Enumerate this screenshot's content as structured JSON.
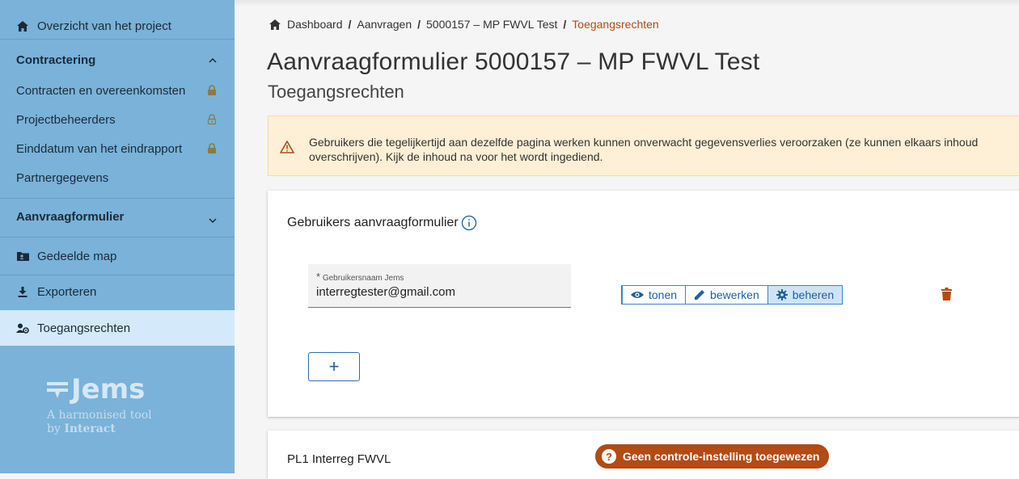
{
  "sidebar": {
    "overview": "Overzicht van het project",
    "contracting": {
      "title": "Contractering",
      "items": [
        {
          "label": "Contracten en overeenkomsten",
          "lock": "locked"
        },
        {
          "label": "Projectbeheerders",
          "lock": "unlocked"
        },
        {
          "label": "Einddatum van het eindrapport",
          "lock": "locked"
        },
        {
          "label": "Partnergegevens"
        }
      ]
    },
    "application_form": "Aanvraagformulier",
    "shared_folder": "Gedeelde map",
    "export": "Exporteren",
    "access_rights": "Toegangsrechten",
    "logo": {
      "name": "Jems",
      "tagline_1": "A harmonised tool",
      "tagline_2_prefix": "by ",
      "tagline_2_brand": "Interact"
    }
  },
  "breadcrumb": {
    "items": [
      "Dashboard",
      "Aanvragen",
      "5000157 – MP FWVL Test"
    ],
    "current": "Toegangsrechten",
    "separator": "/"
  },
  "page": {
    "title": "Aanvraagformulier 5000157 – MP FWVL Test",
    "subtitle": "Toegangsrechten"
  },
  "warning": {
    "text": "Gebruikers die tegelijkertijd aan dezelfde pagina werken kunnen onverwacht gegevensverlies veroorzaken (ze kunnen elkaars inhoud overschrijven). Kijk de inhoud na voor het wordt ingediend."
  },
  "users_card": {
    "title": "Gebruikers aanvraagformulier",
    "field_label": "Gebruikersnaam Jems",
    "field_required_mark": "*",
    "field_value": "interregtester@gmail.com",
    "permissions": [
      {
        "label": "tonen",
        "icon": "eye-icon",
        "selected": false
      },
      {
        "label": "bewerken",
        "icon": "pencil-icon",
        "selected": false
      },
      {
        "label": "beheren",
        "icon": "gear-icon",
        "selected": true
      }
    ],
    "add_label": "+"
  },
  "partner_card": {
    "title": "PL1 Interreg FWVL",
    "badge": "Geen controle-instelling toegewezen",
    "badge_icon": "?"
  },
  "colors": {
    "sidebar": "#7ab2d9",
    "sidebar_active": "#d4e9f9",
    "accent": "#b24b14",
    "primary": "#1f5f9e",
    "warning_bg": "#fdf0d6"
  }
}
